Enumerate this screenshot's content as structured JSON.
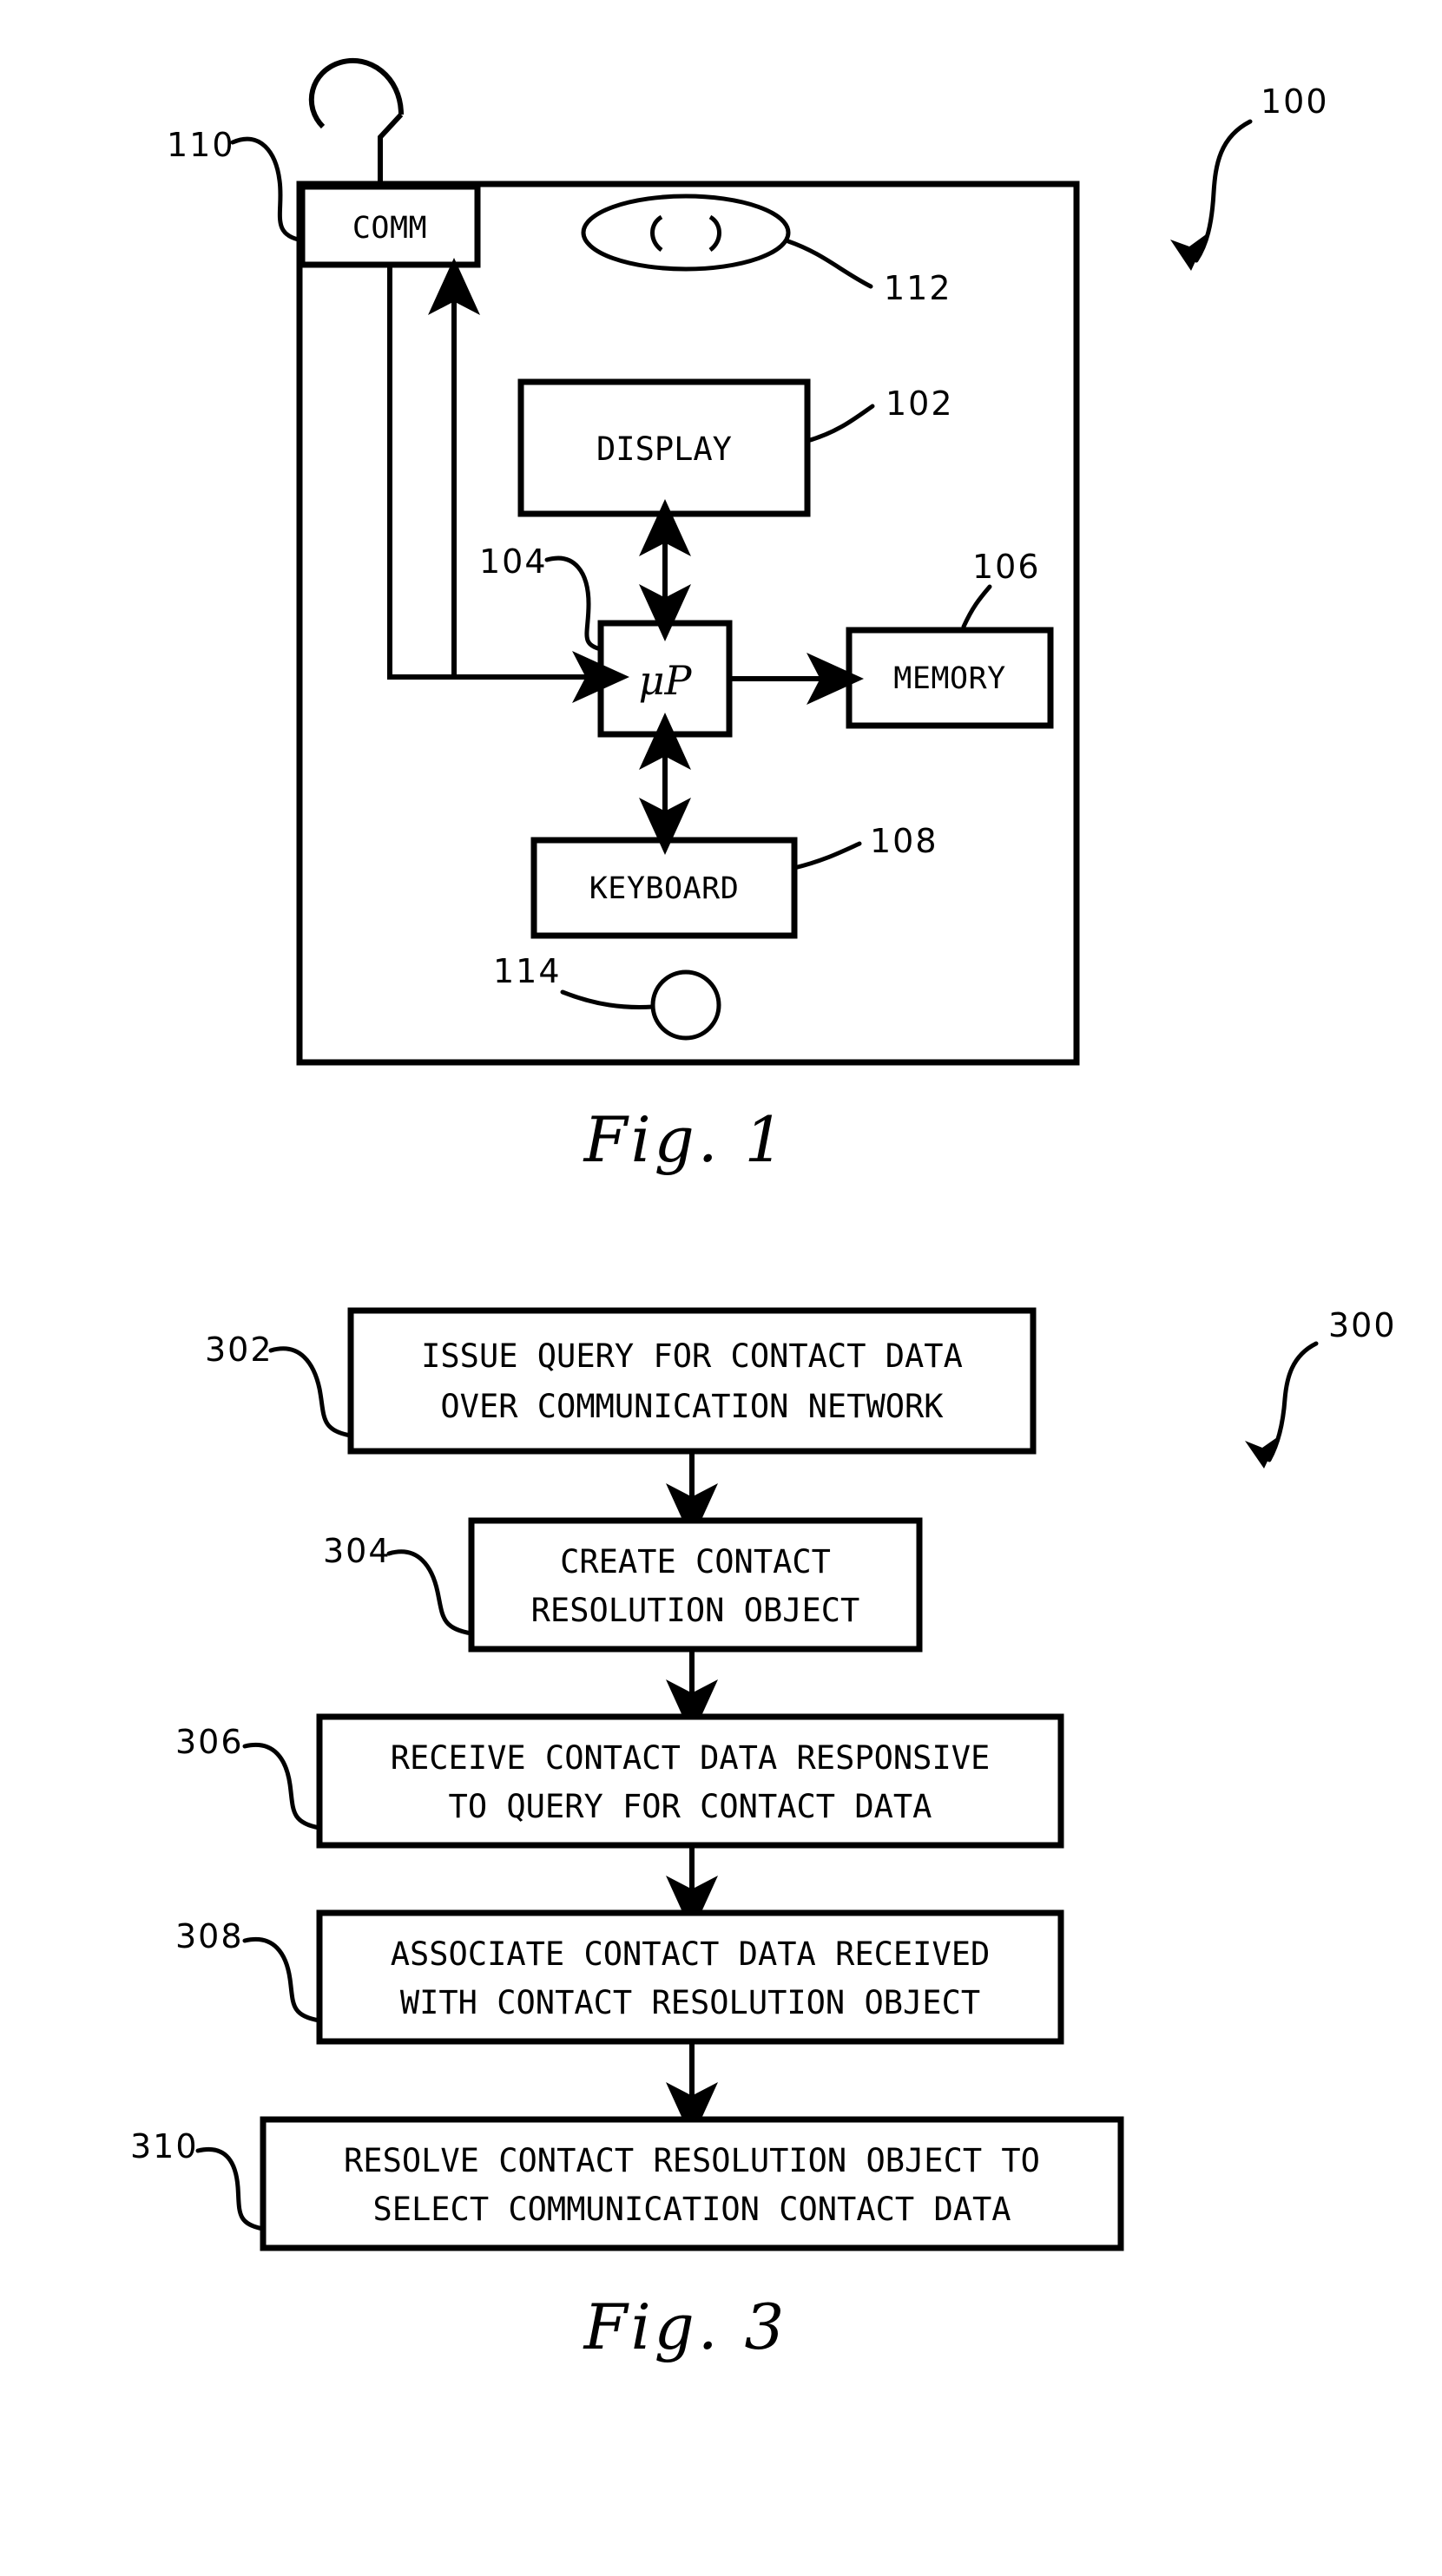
{
  "document": {
    "type": "patent-drawing-sheet",
    "background_color": "#ffffff",
    "ink_color": "#000000"
  },
  "figure1": {
    "caption": "Fig. 1",
    "assembly_ref": "100",
    "blocks": [
      {
        "id": "comm",
        "label": "COMM",
        "ref": "110"
      },
      {
        "id": "display",
        "label": "DISPLAY",
        "ref": "102"
      },
      {
        "id": "micro",
        "label": "μP",
        "ref": "104"
      },
      {
        "id": "memory",
        "label": "MEMORY",
        "ref": "106"
      },
      {
        "id": "keyboard",
        "label": "KEYBOARD",
        "ref": "108"
      }
    ],
    "annotations": [
      {
        "id": "speaker",
        "ref": "112",
        "glyph": "( )"
      },
      {
        "id": "microphone",
        "ref": "114",
        "glyph": ""
      }
    ],
    "refs": {
      "comm": "110",
      "display": "102",
      "micro": "104",
      "memory": "106",
      "keyboard": "108",
      "speaker": "112",
      "microphone": "114",
      "assembly": "100"
    },
    "labels": {
      "comm": "COMM",
      "display": "DISPLAY",
      "micro": "μP",
      "memory": "MEMORY",
      "keyboard": "KEYBOARD",
      "speaker_glyph": "( )"
    }
  },
  "figure3": {
    "caption": "Fig. 3",
    "flow_ref": "300",
    "steps": [
      {
        "ref": "302",
        "lines": [
          "ISSUE QUERY FOR CONTACT DATA",
          "OVER COMMUNICATION NETWORK"
        ]
      },
      {
        "ref": "304",
        "lines": [
          "CREATE CONTACT",
          "RESOLUTION OBJECT"
        ]
      },
      {
        "ref": "306",
        "lines": [
          "RECEIVE CONTACT DATA RESPONSIVE",
          "TO QUERY FOR CONTACT DATA"
        ]
      },
      {
        "ref": "308",
        "lines": [
          "ASSOCIATE CONTACT DATA RECEIVED",
          "WITH CONTACT RESOLUTION OBJECT"
        ]
      },
      {
        "ref": "310",
        "lines": [
          "RESOLVE CONTACT RESOLUTION OBJECT TO",
          "SELECT COMMUNICATION CONTACT DATA"
        ]
      }
    ],
    "step_text": {
      "s302_l1": "ISSUE QUERY FOR CONTACT DATA",
      "s302_l2": "OVER COMMUNICATION NETWORK",
      "s304_l1": "CREATE CONTACT",
      "s304_l2": "RESOLUTION OBJECT",
      "s306_l1": "RECEIVE CONTACT DATA RESPONSIVE",
      "s306_l2": "TO QUERY FOR CONTACT DATA",
      "s308_l1": "ASSOCIATE CONTACT DATA RECEIVED",
      "s308_l2": "WITH CONTACT RESOLUTION OBJECT",
      "s310_l1": "RESOLVE CONTACT RESOLUTION OBJECT TO",
      "s310_l2": "SELECT COMMUNICATION CONTACT DATA"
    },
    "step_refs": {
      "s302": "302",
      "s304": "304",
      "s306": "306",
      "s308": "308",
      "s310": "310"
    }
  }
}
